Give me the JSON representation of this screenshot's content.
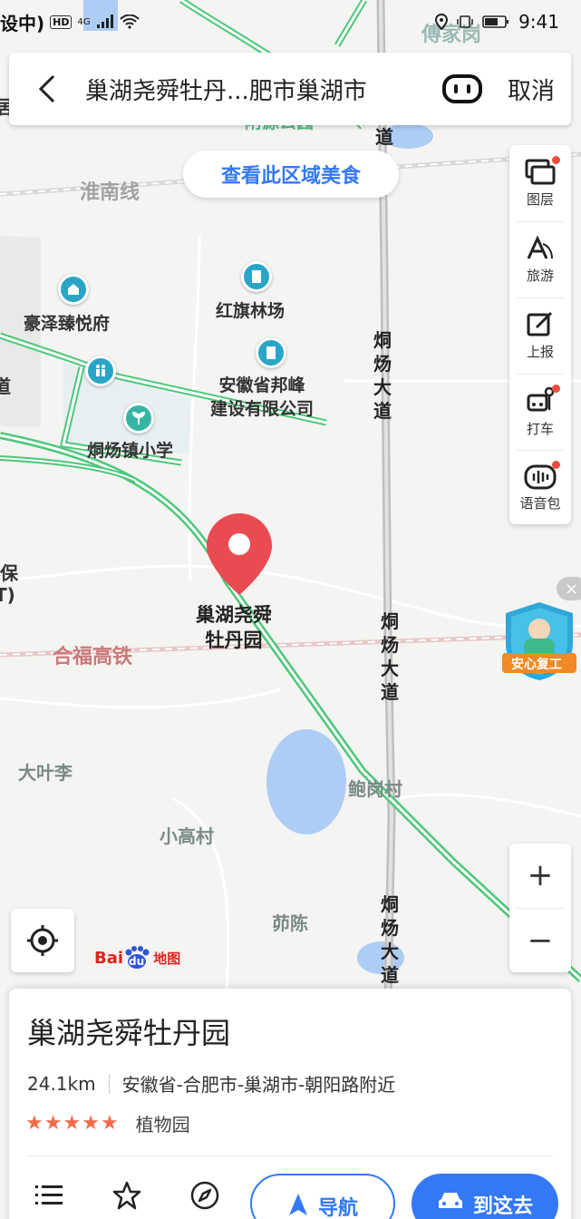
{
  "status_bar": {
    "carrier": "设中)",
    "hd": "HD",
    "network": "4G",
    "time": "9:41"
  },
  "search": {
    "title": "巢湖尧舜牡丹...肥市巢湖市",
    "cancel_label": "取消"
  },
  "food_button": "查看此区域美食",
  "toolbar": {
    "items": [
      {
        "label": "图层",
        "icon": "layers-icon",
        "has_dot": true
      },
      {
        "label": "旅游",
        "icon": "travel-icon",
        "has_dot": false
      },
      {
        "label": "上报",
        "icon": "report-icon",
        "has_dot": false
      },
      {
        "label": "打车",
        "icon": "taxi-icon",
        "has_dot": true
      },
      {
        "label": "语音包",
        "icon": "voice-pack-icon",
        "has_dot": true
      }
    ]
  },
  "map": {
    "labels": {
      "fuJiaGang": "傅家岗",
      "huaiNanXian": "淮南线",
      "haoZe": "豪泽臻悦府",
      "hongQi": "红旗林场",
      "bangFeng": "安徽省邦峰\n建设有限公司",
      "tongYangSchool": "烔炀镇小学",
      "tongYangRoad1": "烔炀大道",
      "tongYangRoad2": "烔炀大道",
      "tongYangRoad3": "烔炀大道",
      "topRoad": "道",
      "heFuRail": "合福高铁",
      "daYeLi": "大叶李",
      "baoGang": "鲍岗村",
      "xiaoGao": "小高村",
      "ruChen": "茆陈",
      "bao": "保",
      "bracket": "T)",
      "ju": "居",
      "dao": "道",
      "pinLabel": "巢湖尧舜\n牡丹园",
      "partial": "附源公园"
    },
    "marker_color": "#e94b52"
  },
  "badge": {
    "label": "安心复工"
  },
  "zoom": {
    "plus": "+",
    "minus": "−"
  },
  "brand": {
    "part1": "Bai",
    "part2": "du",
    "part3": "地图"
  },
  "place": {
    "name": "巢湖尧舜牡丹园",
    "distance": "24.1km",
    "address": "安徽省-合肥市-巢湖市-朝阳路附近",
    "rating_stars": 5,
    "category": "植物园"
  },
  "actions": {
    "navigate_label": "导航",
    "go_label": "到这去"
  },
  "colors": {
    "accent": "#3478f6",
    "road_green": "#4cc77a",
    "rail": "#c97a7a",
    "water": "#aecdf5"
  }
}
